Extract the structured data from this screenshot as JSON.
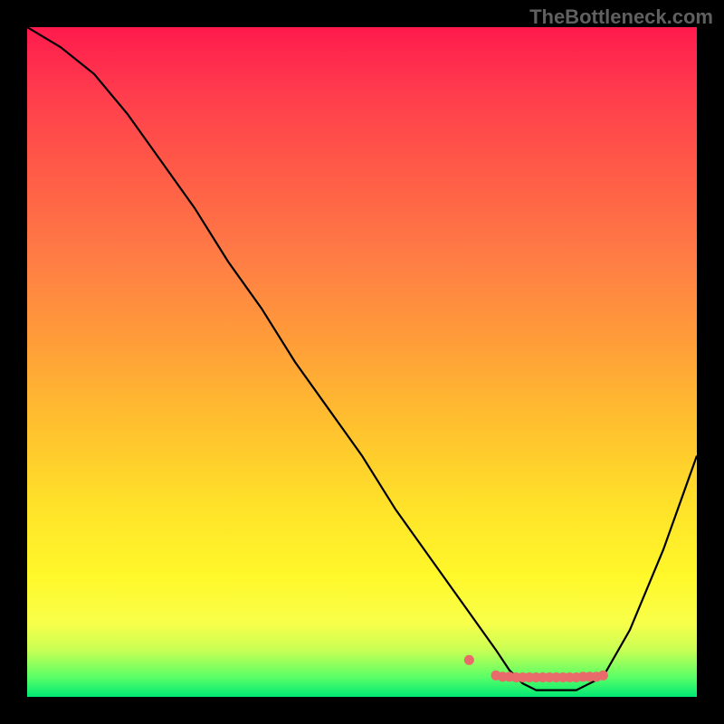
{
  "watermark": "TheBottleneck.com",
  "chart_data": {
    "type": "line",
    "title": "",
    "xlabel": "",
    "ylabel": "",
    "xlim": [
      0,
      100
    ],
    "ylim": [
      0,
      100
    ],
    "series": [
      {
        "name": "curve",
        "x": [
          0,
          5,
          10,
          15,
          20,
          25,
          30,
          35,
          40,
          45,
          50,
          55,
          60,
          65,
          70,
          72,
          74,
          76,
          78,
          80,
          82,
          84,
          86,
          90,
          95,
          100
        ],
        "values": [
          100,
          97,
          93,
          87,
          80,
          73,
          65,
          58,
          50,
          43,
          36,
          28,
          21,
          14,
          7,
          4,
          2,
          1,
          1,
          1,
          1,
          2,
          3,
          10,
          22,
          36
        ]
      },
      {
        "name": "highlight_dots",
        "x": [
          66,
          70,
          71,
          72,
          73,
          74,
          75,
          76,
          77,
          78,
          79,
          80,
          81,
          82,
          83,
          84,
          85,
          86
        ],
        "values": [
          5.5,
          3.2,
          3.0,
          3.0,
          2.9,
          2.9,
          2.9,
          2.9,
          2.9,
          2.9,
          2.9,
          2.9,
          2.9,
          2.9,
          3.0,
          3.0,
          3.0,
          3.2
        ]
      }
    ],
    "colors": {
      "curve": "#000000",
      "dots": "#e86a6a",
      "gradient_top": "#ff1a4d",
      "gradient_bottom": "#00e874"
    }
  }
}
